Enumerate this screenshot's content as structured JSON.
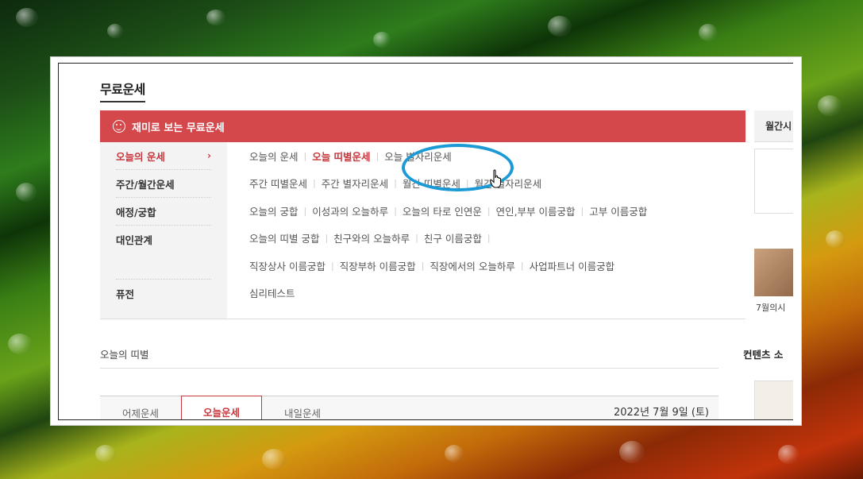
{
  "page": {
    "title": "무료운세"
  },
  "panel": {
    "header": "재미로 보는 무료운세",
    "side_items": [
      {
        "label": "오늘의 운세",
        "active": true,
        "chevron": "›"
      },
      {
        "label": "주간/월간운세"
      },
      {
        "label": "애정/궁합"
      },
      {
        "label": "대인관계"
      },
      {
        "label": "퓨전"
      }
    ],
    "rows": [
      [
        "오늘의 운세",
        "오늘 띠별운세",
        "오늘 별자리운세"
      ],
      [
        "주간 띠별운세",
        "주간 별자리운세",
        "월간 띠별운세",
        "월간 별자리운세"
      ],
      [
        "오늘의 궁합",
        "이성과의 오늘하루",
        "오늘의 타로 인연운",
        "연인,부부 이름궁합",
        "고부 이름궁합"
      ],
      [
        "오늘의 띠별 궁합",
        "친구와의 오늘하루",
        "친구 이름궁합"
      ],
      [
        "직장상사 이름궁합",
        "직장부하 이름궁합",
        "직장에서의 오늘하루",
        "사업파트너 이름궁합"
      ],
      [
        "심리테스트"
      ]
    ]
  },
  "right": {
    "head": "월간시",
    "caption": "7월의시",
    "section_title": "컨텐츠 소"
  },
  "section": {
    "title": "오늘의 띠별"
  },
  "tabs": [
    {
      "label": "어제운세"
    },
    {
      "label": "오늘운세",
      "active": true
    },
    {
      "label": "내일운세"
    }
  ],
  "date": "2022년 7월 9일 (토)",
  "colors": {
    "accent": "#d4484c",
    "active_text": "#c8373c",
    "ring": "#1b9ad6"
  },
  "icons": {
    "header": "smile-icon",
    "cursor": "hand-pointer-icon"
  }
}
